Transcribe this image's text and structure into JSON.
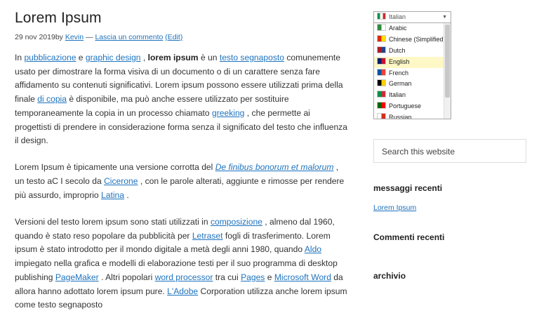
{
  "post": {
    "title": "Lorem Ipsum",
    "meta": {
      "date": "29 nov 2019",
      "by": "by",
      "author": "Kevin",
      "dash": "—",
      "comment_link": "Lascia un commento",
      "edit_link": "(Edit)"
    },
    "p1": {
      "t1": "In ",
      "l1": "pubblicazione",
      "t2": " e ",
      "l2": "graphic design",
      "t3": ", ",
      "b1": "lorem ipsum",
      "t4": " è un ",
      "l3": "testo segnaposto",
      "t5": " comunemente usato per dimostrare la forma visiva di un documento o di un carattere senza fare affidamento su contenuti significativi. Lorem ipsum possono essere utilizzati prima della finale ",
      "l4": "di copia",
      "t6": " è disponibile, ma può anche essere utilizzato per sostituire temporaneamente la copia in un processo chiamato ",
      "l5": "greeking",
      "t7": ", che permette ai progettisti di prendere in considerazione forma senza il significato del testo che influenza il design."
    },
    "p2": {
      "t1": "Lorem Ipsum è tipicamente una versione corrotta del ",
      "l1": "De finibus bonorum et malorum",
      "t2": ", un testo aC I secolo da ",
      "l2": "Cicerone",
      "t3": ", con le parole alterati, aggiunte e rimosse per rendere più assurdo, improprio ",
      "l3": "Latina",
      "t4": "."
    },
    "p3": {
      "t1": "Versioni del testo lorem ipsum sono stati utilizzati in ",
      "l1": "composizione",
      "t2": " , almeno dal 1960, quando è stato reso popolare da pubblicità per ",
      "l2": "Letraset",
      "t3": " fogli di trasferimento. Lorem ipsum è stato introdotto per il mondo digitale a metà degli anni 1980, quando ",
      "l3": "Aldo",
      "t4": " impiegato nella grafica e modelli di elaborazione testi per il suo programma di desktop publishing ",
      "l4": "PageMaker",
      "t5": ". Altri popolari ",
      "l5": "word processor",
      "t6": " tra cui ",
      "l6": "Pages",
      "t7": " e ",
      "l7": "Microsoft Word",
      "t8": " da allora hanno adottato lorem ipsum pure. ",
      "l8": "L'Adobe",
      "t9": " Corporation utilizza anche lorem ipsum come testo segnaposto"
    }
  },
  "sidebar": {
    "language": {
      "selected": "Italian",
      "items": [
        {
          "label": "Arabic",
          "flag_colors": [
            "#2e8b3a",
            "#ffffff"
          ]
        },
        {
          "label": "Chinese (Simplified)",
          "flag_colors": [
            "#de2910",
            "#ffde00"
          ]
        },
        {
          "label": "Dutch",
          "flag_colors": [
            "#ae1c28",
            "#21468b"
          ]
        },
        {
          "label": "English",
          "flag_colors": [
            "#012169",
            "#c8102e"
          ]
        },
        {
          "label": "French",
          "flag_colors": [
            "#0055a4",
            "#ef4135"
          ]
        },
        {
          "label": "German",
          "flag_colors": [
            "#000000",
            "#ffce00"
          ]
        },
        {
          "label": "Italian",
          "flag_colors": [
            "#009246",
            "#ce2b37"
          ]
        },
        {
          "label": "Portuguese",
          "flag_colors": [
            "#006600",
            "#ff0000"
          ]
        },
        {
          "label": "Russian",
          "flag_colors": [
            "#ffffff",
            "#d52b1e"
          ]
        }
      ],
      "highlighted": "English"
    },
    "search_placeholder": "Search this website",
    "recent_posts_title": "messaggi recenti",
    "recent_posts": [
      "Lorem Ipsum"
    ],
    "recent_comments_title": "Commenti recenti",
    "archive_title": "archivio"
  },
  "colors": {
    "link": "#1e73be",
    "highlight": "#fdf8c6"
  }
}
